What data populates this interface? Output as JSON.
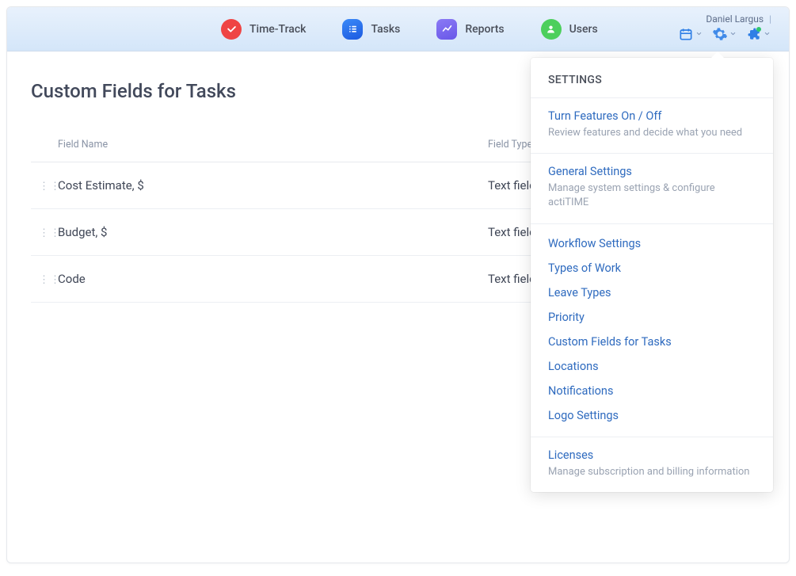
{
  "header": {
    "username": "Daniel Largus",
    "nav": [
      {
        "label": "Time-Track",
        "iconColor": "#ef4444",
        "icon": "check"
      },
      {
        "label": "Tasks",
        "iconColor": "#2f7ff0",
        "icon": "list"
      },
      {
        "label": "Reports",
        "iconColor": "#7c6cf2",
        "icon": "chart"
      },
      {
        "label": "Users",
        "iconColor": "#4ccf5c",
        "icon": "user"
      }
    ]
  },
  "page": {
    "title": "Custom Fields for Tasks",
    "columns": {
      "name": "Field Name",
      "type": "Field Type"
    },
    "rows": [
      {
        "name": "Cost Estimate, $",
        "type": "Text field"
      },
      {
        "name": "Budget, $",
        "type": "Text field"
      },
      {
        "name": "Code",
        "type": "Text field"
      }
    ]
  },
  "popover": {
    "title": "SETTINGS",
    "sections": [
      {
        "title": "Turn Features On / Off",
        "desc": "Review features and decide what you need"
      },
      {
        "title": "General Settings",
        "desc": "Manage system settings & configure actiTIME"
      }
    ],
    "links": [
      "Workflow Settings",
      "Types of Work",
      "Leave Types",
      "Priority",
      "Custom Fields for Tasks",
      "Locations",
      "Notifications",
      "Logo Settings"
    ],
    "footer": {
      "title": "Licenses",
      "desc": "Manage subscription and billing information"
    }
  }
}
